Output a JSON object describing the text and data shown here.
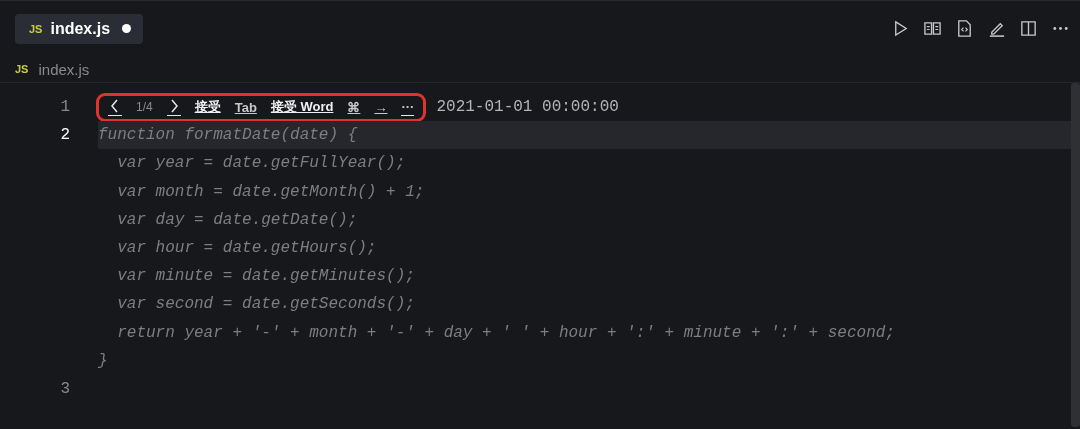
{
  "tabs": [
    {
      "badge": "JS",
      "label": "index.js",
      "selected": true,
      "modified": true
    }
  ],
  "breadcrumb": {
    "badge": "JS",
    "label": "index.js"
  },
  "editor_actions": [
    {
      "kind": "run"
    },
    {
      "kind": "preview"
    },
    {
      "kind": "source"
    },
    {
      "kind": "edit"
    },
    {
      "kind": "split"
    },
    {
      "kind": "more"
    }
  ],
  "suggestion_toolbar": {
    "counter": "1/4",
    "items": [
      {
        "kind": "prev"
      },
      {
        "kind": "counter"
      },
      {
        "kind": "next"
      },
      {
        "kind": "action",
        "label": "接受"
      },
      {
        "kind": "key",
        "label": "Tab"
      },
      {
        "kind": "action",
        "label": "接受 Word"
      },
      {
        "kind": "key",
        "label": "⌘"
      },
      {
        "kind": "key",
        "label": "→"
      },
      {
        "kind": "menu",
        "label": "···"
      }
    ]
  },
  "lines": [
    {
      "number": "1",
      "text": "2021-01-01 00:00:00",
      "active": false,
      "ghost": false,
      "toolbar": true
    },
    {
      "number": "2",
      "text": "function formatDate(date) {",
      "active": true,
      "ghost": true
    },
    {
      "text": "  var year = date.getFullYear();",
      "active": false,
      "ghost": true
    },
    {
      "text": "  var month = date.getMonth() + 1;",
      "active": false,
      "ghost": true
    },
    {
      "text": "  var day = date.getDate();",
      "active": false,
      "ghost": true
    },
    {
      "text": "  var hour = date.getHours();",
      "active": false,
      "ghost": true
    },
    {
      "text": "  var minute = date.getMinutes();",
      "active": false,
      "ghost": true
    },
    {
      "text": "  var second = date.getSeconds();",
      "active": false,
      "ghost": true
    },
    {
      "text": "  return year + '-' + month + '-' + day + ' ' + hour + ':' + minute + ':' + second;",
      "active": false,
      "ghost": true
    },
    {
      "text": "}",
      "active": false,
      "ghost": true
    },
    {
      "number": "3",
      "active": false
    }
  ]
}
